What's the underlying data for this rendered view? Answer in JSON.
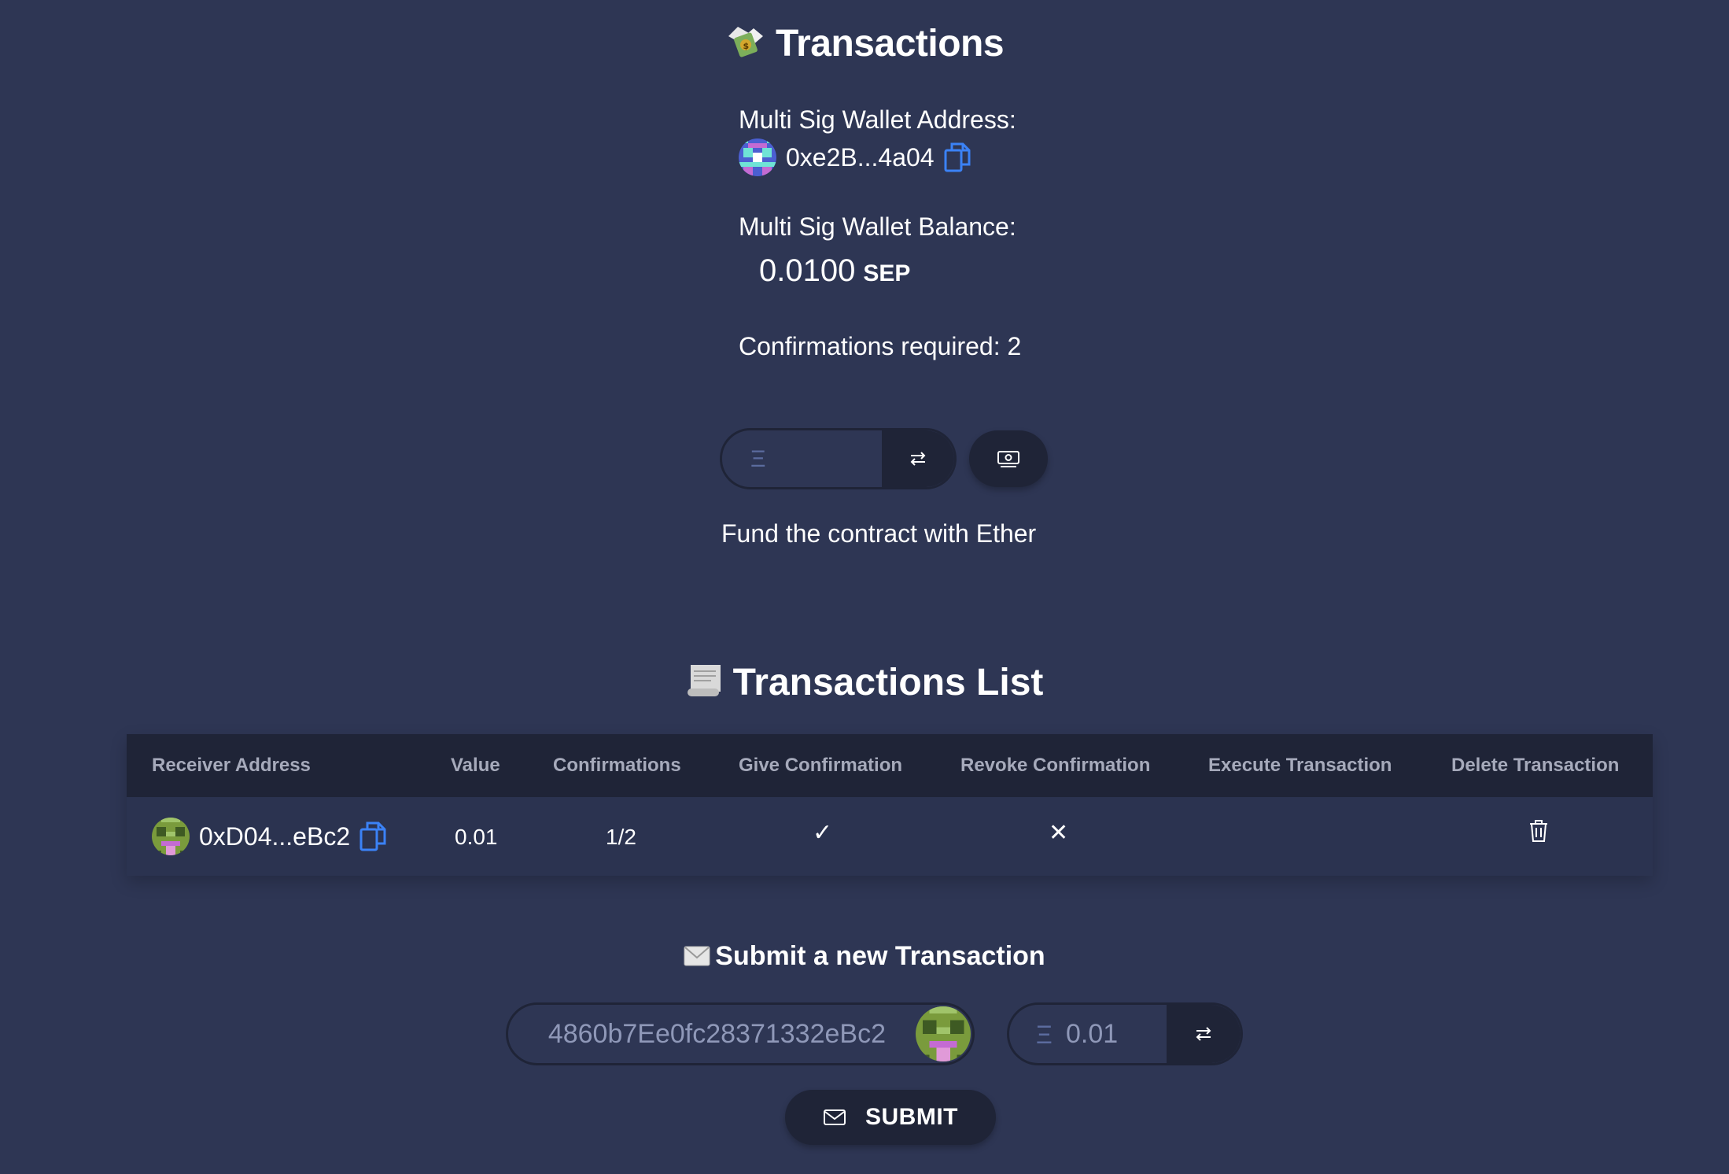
{
  "header": {
    "title": "Transactions",
    "title_icon": "money-with-wings-icon"
  },
  "wallet": {
    "address_label": "Multi Sig Wallet Address:",
    "address": "0xe2B...4a04",
    "balance_label": "Multi Sig Wallet Balance:",
    "balance_value": "0.0100",
    "balance_unit": "SEP",
    "confirmations_label": "Confirmations required: 2"
  },
  "fund": {
    "eth_symbol": "Ξ",
    "caption": "Fund the contract with Ether"
  },
  "tx_list": {
    "title": "Transactions List",
    "title_icon": "scroll-icon",
    "columns": [
      "Receiver Address",
      "Value",
      "Confirmations",
      "Give Confirmation",
      "Revoke Confirmation",
      "Execute Transaction",
      "Delete Transaction"
    ],
    "rows": [
      {
        "receiver": "0xD04...eBc2",
        "value": "0.01",
        "confirmations": "1/2",
        "give": "✓",
        "revoke": "✕"
      }
    ]
  },
  "submit": {
    "title": "Submit a new Transaction",
    "title_icon": "envelope-icon",
    "address_value": "​4860b7Ee0fc28371332eBc2",
    "eth_symbol": "Ξ",
    "amount_value": "0.01",
    "button_label": "SUBMIT"
  },
  "colors": {
    "background": "#2e3654",
    "dark": "#1f2437",
    "accent_copy": "#3b82f6"
  }
}
